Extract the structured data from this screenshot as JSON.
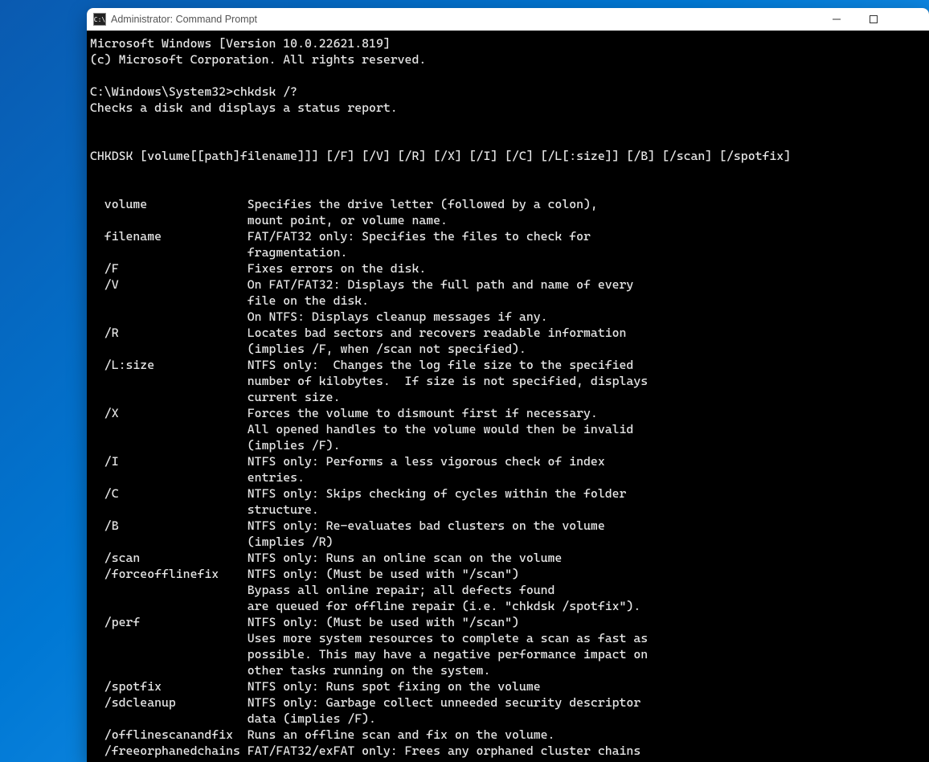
{
  "window": {
    "title": "Administrator: Command Prompt",
    "icon_label": "C:\\"
  },
  "terminal": {
    "header_line1": "Microsoft Windows [Version 10.0.22621.819]",
    "header_line2": "(c) Microsoft Corporation. All rights reserved.",
    "prompt_line": "C:\\Windows\\System32>chkdsk /?",
    "desc_line": "Checks a disk and displays a status report.",
    "syntax_line": "CHKDSK [volume[[path]filename]]] [/F] [/V] [/R] [/X] [/I] [/C] [/L[:size]] [/B] [/scan] [/spotfix]",
    "options": [
      {
        "name": "volume",
        "desc": "Specifies the drive letter (followed by a colon),\n                      mount point, or volume name."
      },
      {
        "name": "filename",
        "desc": "FAT/FAT32 only: Specifies the files to check for\n                      fragmentation."
      },
      {
        "name": "/F",
        "desc": "Fixes errors on the disk."
      },
      {
        "name": "/V",
        "desc": "On FAT/FAT32: Displays the full path and name of every\n                      file on the disk.\n                      On NTFS: Displays cleanup messages if any."
      },
      {
        "name": "/R",
        "desc": "Locates bad sectors and recovers readable information\n                      (implies /F, when /scan not specified)."
      },
      {
        "name": "/L:size",
        "desc": "NTFS only:  Changes the log file size to the specified\n                      number of kilobytes.  If size is not specified, displays\n                      current size."
      },
      {
        "name": "/X",
        "desc": "Forces the volume to dismount first if necessary.\n                      All opened handles to the volume would then be invalid\n                      (implies /F)."
      },
      {
        "name": "/I",
        "desc": "NTFS only: Performs a less vigorous check of index\n                      entries."
      },
      {
        "name": "/C",
        "desc": "NTFS only: Skips checking of cycles within the folder\n                      structure."
      },
      {
        "name": "/B",
        "desc": "NTFS only: Re-evaluates bad clusters on the volume\n                      (implies /R)"
      },
      {
        "name": "/scan",
        "desc": "NTFS only: Runs an online scan on the volume"
      },
      {
        "name": "/forceofflinefix",
        "desc": "NTFS only: (Must be used with \"/scan\")\n                      Bypass all online repair; all defects found\n                      are queued for offline repair (i.e. \"chkdsk /spotfix\")."
      },
      {
        "name": "/perf",
        "desc": "NTFS only: (Must be used with \"/scan\")\n                      Uses more system resources to complete a scan as fast as\n                      possible. This may have a negative performance impact on\n                      other tasks running on the system."
      },
      {
        "name": "/spotfix",
        "desc": "NTFS only: Runs spot fixing on the volume"
      },
      {
        "name": "/sdcleanup",
        "desc": "NTFS only: Garbage collect unneeded security descriptor\n                      data (implies /F)."
      },
      {
        "name": "/offlinescanandfix",
        "desc": "Runs an offline scan and fix on the volume."
      },
      {
        "name": "/freeorphanedchains",
        "desc": "FAT/FAT32/exFAT only: Frees any orphaned cluster chains"
      }
    ]
  }
}
